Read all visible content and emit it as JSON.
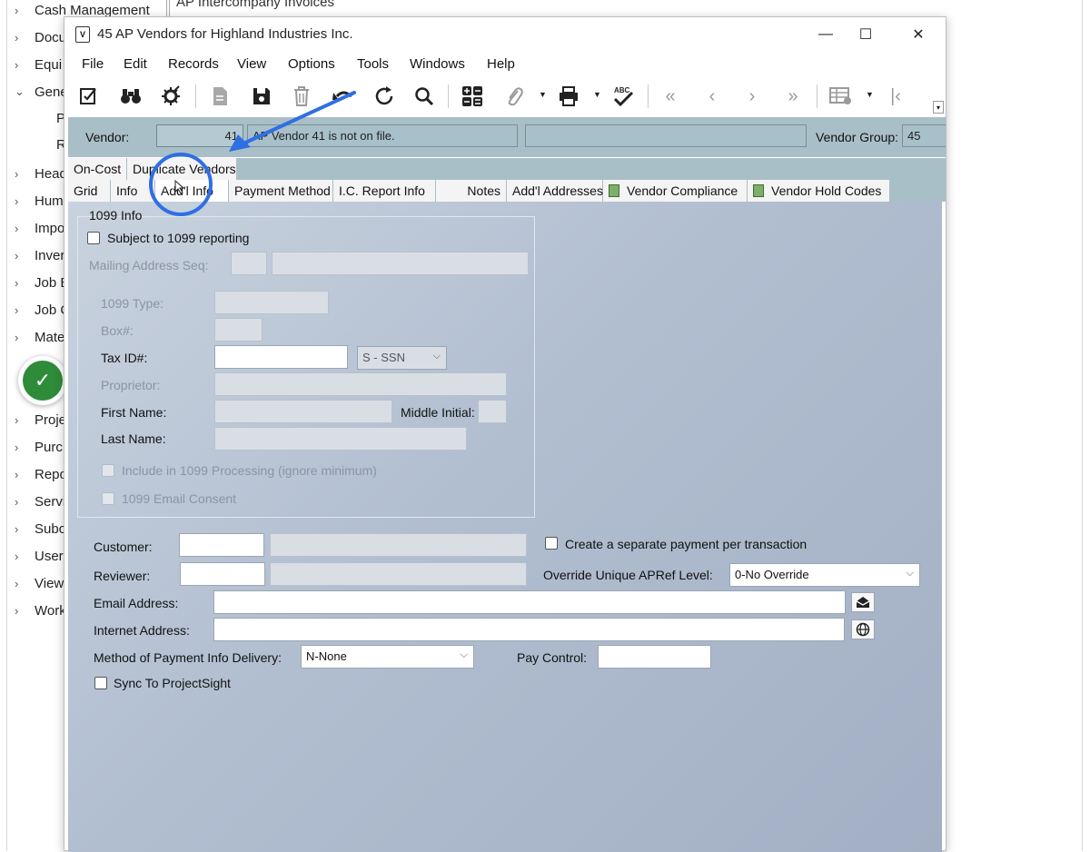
{
  "background_tree": {
    "items": [
      {
        "label": "Cash Management",
        "expanded": false
      },
      {
        "label": "Docu",
        "expanded": false
      },
      {
        "label": "Equi",
        "expanded": false
      },
      {
        "label": "Gene",
        "expanded": true
      },
      {
        "label": "Head",
        "expanded": false
      },
      {
        "label": "Hum",
        "expanded": false
      },
      {
        "label": "Impo",
        "expanded": false
      },
      {
        "label": "Inver",
        "expanded": false
      },
      {
        "label": "Job E",
        "expanded": false
      },
      {
        "label": "Job C",
        "expanded": false
      },
      {
        "label": "Mate",
        "expanded": false
      },
      {
        "label": "Proje",
        "expanded": false
      },
      {
        "label": "Purc",
        "expanded": false
      },
      {
        "label": "Repo",
        "expanded": false
      },
      {
        "label": "Servi",
        "expanded": false
      },
      {
        "label": "Subc",
        "expanded": false
      },
      {
        "label": "User",
        "expanded": false
      },
      {
        "label": "View",
        "expanded": false
      },
      {
        "label": "Work",
        "expanded": false
      }
    ],
    "sub_items": [
      "P",
      "R"
    ],
    "bg_tab_text": "AP Intercompany Invoices"
  },
  "badge": {
    "icon": "checkmark-icon",
    "glyph": "✓",
    "color": "#2e8b3a"
  },
  "window": {
    "title": "45 AP Vendors for Highland Industries Inc.",
    "controls": {
      "minimize": "—",
      "maximize": "☐",
      "close": "✕"
    }
  },
  "menu": [
    "File",
    "Edit",
    "Records",
    "View",
    "Options",
    "Tools",
    "Windows",
    "Help"
  ],
  "toolbar_icons": [
    "edit-checklist-icon",
    "binoculars-icon",
    "settings-bug-icon",
    "document-icon",
    "save-icon",
    "delete-icon",
    "undo-icon",
    "refresh-icon",
    "search-icon",
    "calculator-icon",
    "attachment-icon",
    "print-icon",
    "spellcheck-icon",
    "first-record-icon",
    "previous-record-icon",
    "next-record-icon",
    "last-record-icon",
    "grid-settings-icon",
    "goto-start-icon"
  ],
  "header": {
    "vendor_label": "Vendor:",
    "vendor_value": "41",
    "vendor_message": "AP Vendor 41 is not on file.",
    "vendor_group_label": "Vendor Group:",
    "vendor_group_value": "45"
  },
  "tabs_row1": [
    "On-Cost",
    "Duplicate Vendors"
  ],
  "tabs_row2": [
    "Grid",
    "Info",
    "Add'l Info",
    "Payment Method",
    "I.C. Report Info",
    "Notes",
    "Add'l Addresses",
    "Vendor Compliance",
    "Vendor Hold Codes"
  ],
  "active_tab": "Add'l Info",
  "form_1099": {
    "legend": "1099 Info",
    "subject_to_1099": "Subject to 1099 reporting",
    "mailing_address_seq": "Mailing Address Seq:",
    "type_1099": "1099 Type:",
    "box": "Box#:",
    "tax_id": "Tax ID#:",
    "tax_id_type": "S - SSN",
    "proprietor": "Proprietor:",
    "first_name": "First Name:",
    "middle_initial": "Middle Initial:",
    "last_name": "Last Name:",
    "include_in_processing": "Include in 1099 Processing (ignore minimum)",
    "email_consent": "1099 Email Consent"
  },
  "form_lower": {
    "customer": "Customer:",
    "reviewer": "Reviewer:",
    "separate_payment": "Create a separate payment per transaction",
    "override_apref": "Override Unique APRef Level:",
    "override_apref_value": "0-No Override",
    "email_address": "Email Address:",
    "internet_address": "Internet Address:",
    "method_payment_delivery": "Method of Payment Info Delivery:",
    "method_payment_delivery_value": "N-None",
    "pay_control": "Pay Control:",
    "sync_projectsight": "Sync To ProjectSight"
  },
  "annotation": {
    "color": "#2f6fe4"
  }
}
